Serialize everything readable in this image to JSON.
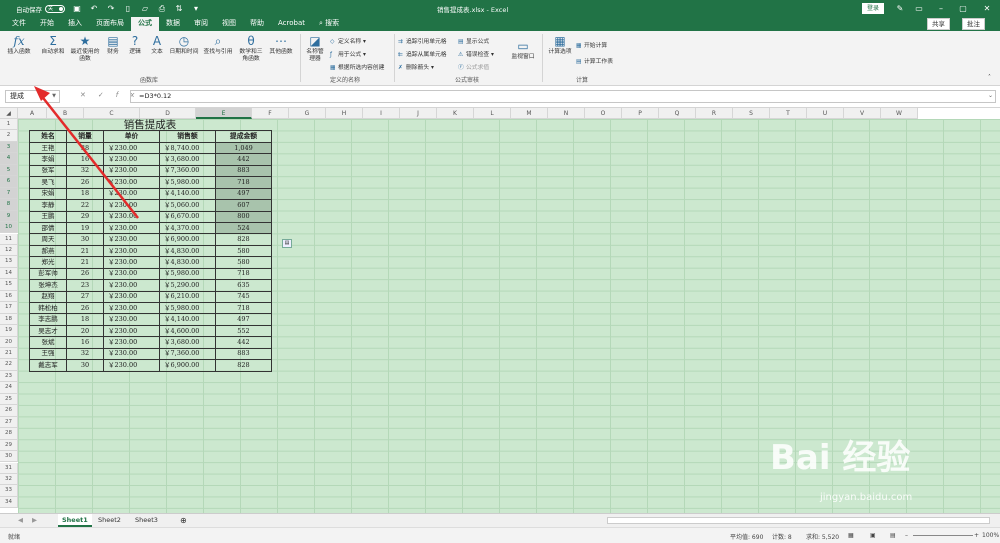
{
  "titlebar": {
    "autosave_label": "自动保存",
    "toggle": "关",
    "doc_title": "销售提成表.xlsx - Excel",
    "login": "登录"
  },
  "menu": {
    "tabs": [
      "文件",
      "开始",
      "插入",
      "页面布局",
      "公式",
      "数据",
      "审阅",
      "视图",
      "帮助",
      "Acrobat"
    ],
    "active": "公式",
    "search": "搜索",
    "share": "共享",
    "comment": "批注"
  },
  "ribbon": {
    "big_buttons": [
      {
        "label": "插入函数",
        "icon": "fx-icon"
      },
      {
        "label": "自动求和",
        "icon": "sum-icon"
      },
      {
        "label": "最近使用的函数",
        "icon": "recent-icon"
      },
      {
        "label": "财务",
        "icon": "finance-icon"
      },
      {
        "label": "逻辑",
        "icon": "logic-icon"
      },
      {
        "label": "文本",
        "icon": "text-icon"
      },
      {
        "label": "日期和时间",
        "icon": "clock-icon"
      },
      {
        "label": "查找与引用",
        "icon": "lookup-icon"
      },
      {
        "label": "数学和三角函数",
        "icon": "math-icon"
      },
      {
        "label": "其他函数",
        "icon": "more-icon"
      },
      {
        "label": "名称管理器",
        "icon": "name-manager-icon"
      }
    ],
    "names_items": [
      "定义名称",
      "用于公式",
      "根据所选内容创建"
    ],
    "audit_items": [
      "追踪引用单元格",
      "追踪从属单元格",
      "删除箭头",
      "显示公式",
      "错误检查",
      "公式求值"
    ],
    "watch": "监视窗口",
    "calc_items": [
      "计算选项",
      "开始计算",
      "计算工作表"
    ],
    "groups": [
      "函数库",
      "定义的名称",
      "公式审核",
      "计算"
    ]
  },
  "formula_bar": {
    "namebox": "提成",
    "formula": "=D3*0.12"
  },
  "columns": [
    "A",
    "B",
    "C",
    "D",
    "E",
    "F",
    "G",
    "H",
    "I",
    "J",
    "K",
    "L",
    "M",
    "N",
    "O",
    "P",
    "Q",
    "R",
    "S",
    "T",
    "U",
    "V",
    "W"
  ],
  "selected_column": "E",
  "rows": [
    "1",
    "2",
    "3",
    "4",
    "5",
    "6",
    "7",
    "8",
    "9",
    "10",
    "11",
    "12",
    "13",
    "14",
    "15",
    "16",
    "17",
    "18",
    "19",
    "20",
    "21",
    "22",
    "23",
    "24",
    "25",
    "26",
    "27",
    "28",
    "29",
    "30",
    "31",
    "32",
    "33",
    "34"
  ],
  "table": {
    "title": "销售提成表",
    "headers": [
      "姓名",
      "销量",
      "单价",
      "销售额",
      "提成金额"
    ],
    "rows": [
      [
        "王艳",
        "38",
        "￥230.00",
        "￥8,740.00",
        "1,049"
      ],
      [
        "李娟",
        "16",
        "￥230.00",
        "￥3,680.00",
        "442"
      ],
      [
        "张军",
        "32",
        "￥230.00",
        "￥7,360.00",
        "883"
      ],
      [
        "吴飞",
        "26",
        "￥230.00",
        "￥5,980.00",
        "718"
      ],
      [
        "宋娟",
        "18",
        "￥230.00",
        "￥4,140.00",
        "497"
      ],
      [
        "李静",
        "22",
        "￥230.00",
        "￥5,060.00",
        "607"
      ],
      [
        "王鹏",
        "29",
        "￥230.00",
        "￥6,670.00",
        "800"
      ],
      [
        "邵倩",
        "19",
        "￥230.00",
        "￥4,370.00",
        "524"
      ],
      [
        "周天",
        "30",
        "￥230.00",
        "￥6,900.00",
        "828"
      ],
      [
        "郝燕",
        "21",
        "￥230.00",
        "￥4,830.00",
        "580"
      ],
      [
        "郑光",
        "21",
        "￥230.00",
        "￥4,830.00",
        "580"
      ],
      [
        "彭军帅",
        "26",
        "￥230.00",
        "￥5,980.00",
        "718"
      ],
      [
        "张坤杰",
        "23",
        "￥230.00",
        "￥5,290.00",
        "635"
      ],
      [
        "赵翔",
        "27",
        "￥230.00",
        "￥6,210.00",
        "745"
      ],
      [
        "韩松柏",
        "26",
        "￥230.00",
        "￥5,980.00",
        "718"
      ],
      [
        "李志鹏",
        "18",
        "￥230.00",
        "￥4,140.00",
        "497"
      ],
      [
        "吴志才",
        "20",
        "￥230.00",
        "￥4,600.00",
        "552"
      ],
      [
        "张斌",
        "16",
        "￥230.00",
        "￥3,680.00",
        "442"
      ],
      [
        "王强",
        "32",
        "￥230.00",
        "￥7,360.00",
        "883"
      ],
      [
        "戴志军",
        "30",
        "￥230.00",
        "￥6,900.00",
        "828"
      ]
    ],
    "selected_rows": [
      0,
      1,
      2,
      3,
      4,
      5,
      6,
      7
    ]
  },
  "sheets": [
    "Sheet1",
    "Sheet2",
    "Sheet3"
  ],
  "active_sheet": "Sheet1",
  "status": {
    "ready": "就绪",
    "average": "平均值: 690",
    "count": "计数: 8",
    "sum": "求和: 5,520",
    "zoom": "100%"
  },
  "watermark": {
    "logo": "Bai  经验",
    "url": "jingyan.baidu.com"
  },
  "colors": {
    "brand": "#217346",
    "sheet_bg": "#cce8cf",
    "arrow": "#e32b2b"
  }
}
